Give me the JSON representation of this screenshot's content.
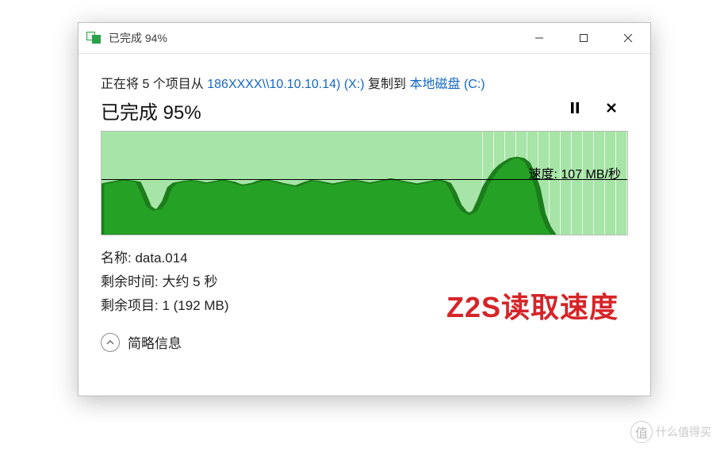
{
  "window": {
    "title": "已完成 94%"
  },
  "line1": {
    "prefix": "正在将 5 个项目从 ",
    "source": "186XXXX\\\\10.10.10.14) (X:)",
    "mid": " 复制到 ",
    "dest": "本地磁盘 (C:)"
  },
  "progress_line": "已完成 95%",
  "speed_label": "速度: 107 MB/秒",
  "meta": {
    "name_label": "名称: ",
    "name_value": "data.014",
    "time_label": "剩余时间: ",
    "time_value": "大约 5 秒",
    "items_label": "剩余项目: ",
    "items_value": "1 (192 MB)"
  },
  "more_label": "简略信息",
  "annotation": "Z2S读取速度",
  "watermark": "什么值得买",
  "chart_data": {
    "type": "area",
    "title": "传输速度",
    "ylabel": "MB/秒",
    "ylim": [
      0,
      200
    ],
    "current_speed_mbps": 107,
    "baseline_mbps": 107,
    "x": [
      0,
      1,
      2,
      3,
      4,
      5,
      6,
      7,
      8,
      9,
      10,
      11,
      12,
      13,
      14,
      15,
      16,
      17,
      18,
      19,
      20,
      21,
      22,
      23,
      24,
      25,
      26,
      27,
      28,
      29,
      30,
      31,
      32,
      33,
      34,
      35,
      36,
      37,
      38,
      39,
      40,
      41,
      42,
      43,
      44,
      45,
      46,
      47,
      48,
      49,
      50,
      51,
      52,
      53,
      54,
      55,
      56,
      57,
      58,
      59,
      60,
      61,
      62,
      63,
      64,
      65,
      66,
      67,
      68,
      69,
      70,
      71,
      72,
      73,
      74,
      75,
      76,
      77,
      78,
      79,
      80,
      81,
      82,
      83,
      84,
      85,
      86
    ],
    "values_mbps": [
      98,
      100,
      102,
      104,
      106,
      105,
      104,
      102,
      80,
      55,
      48,
      50,
      65,
      92,
      100,
      102,
      104,
      105,
      104,
      102,
      100,
      102,
      104,
      106,
      104,
      102,
      98,
      96,
      98,
      100,
      104,
      106,
      105,
      103,
      100,
      98,
      96,
      94,
      98,
      102,
      105,
      104,
      102,
      100,
      98,
      100,
      102,
      104,
      105,
      104,
      102,
      100,
      102,
      104,
      106,
      108,
      106,
      104,
      102,
      100,
      98,
      100,
      102,
      104,
      106,
      104,
      100,
      82,
      58,
      45,
      40,
      46,
      68,
      94,
      110,
      125,
      135,
      142,
      148,
      150,
      148,
      140,
      120,
      90,
      40,
      15,
      0
    ]
  }
}
